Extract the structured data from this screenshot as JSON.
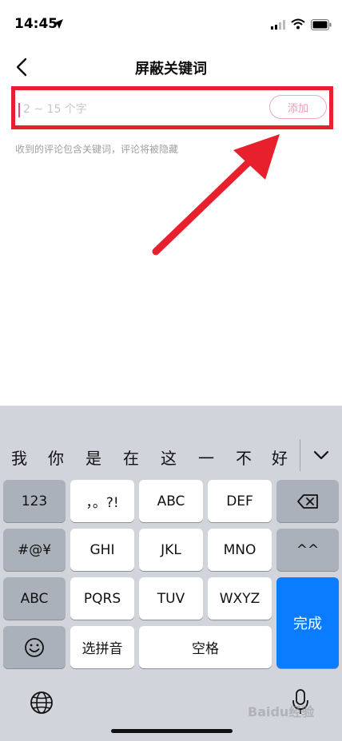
{
  "status_bar": {
    "time": "14:45"
  },
  "nav": {
    "title": "屏蔽关键词"
  },
  "keyword_input": {
    "placeholder": "2 ~ 15 个字",
    "value": ""
  },
  "add_button": {
    "label": "添加"
  },
  "helper_text": "收到的评论包含关键词，评论将被隐藏",
  "keyboard": {
    "candidates": [
      "我",
      "你",
      "是",
      "在",
      "这",
      "一",
      "不",
      "好"
    ],
    "row1": [
      "123",
      "，。?!",
      "ABC",
      "DEF"
    ],
    "row2": [
      "#@¥",
      "GHI",
      "JKL",
      "MNO",
      "^^"
    ],
    "row3": [
      "ABC",
      "PQRS",
      "TUV",
      "WXYZ"
    ],
    "row4": [
      "选拼音",
      "空格"
    ],
    "done_label": "完成"
  },
  "watermark": "Baidu经验",
  "colors": {
    "highlight_red": "#e8202d",
    "accent_pink": "#ec9ab3",
    "done_blue": "#0a7cff",
    "keyboard_bg": "#d1d4db"
  }
}
